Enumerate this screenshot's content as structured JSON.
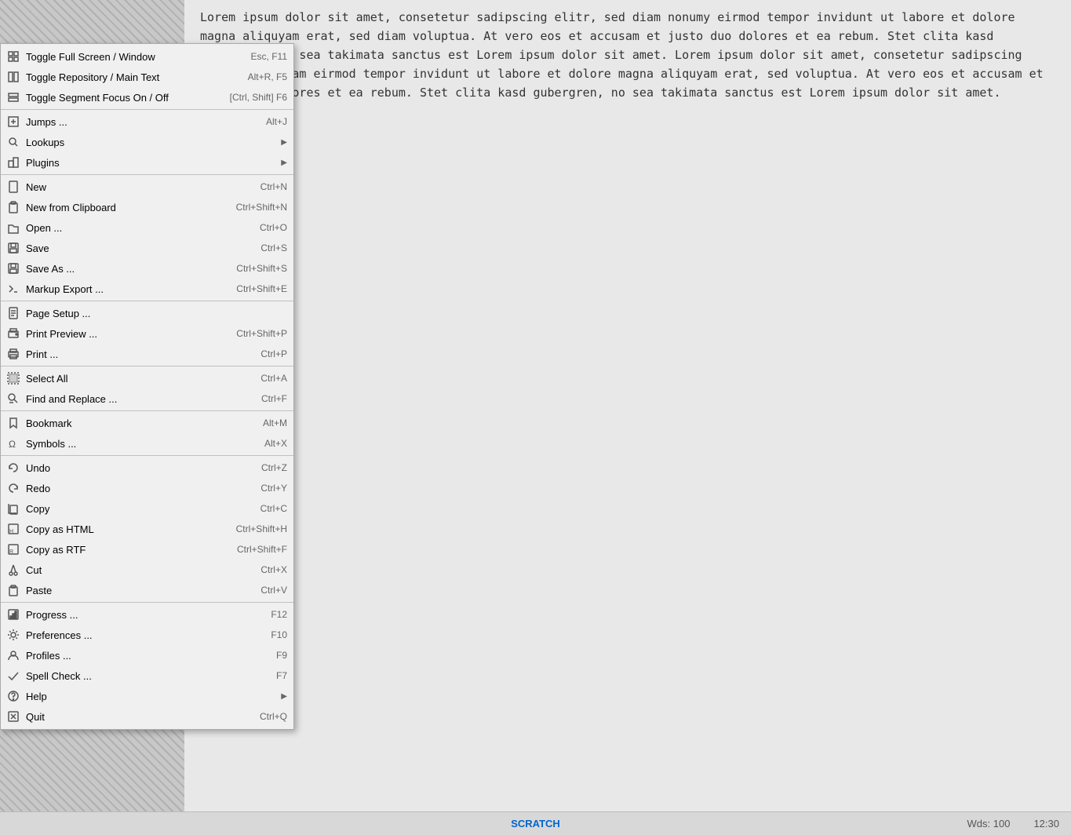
{
  "app": {
    "status": {
      "scratch_label": "SCRATCH",
      "wds_label": "Wds: 100",
      "time_label": "12:30"
    },
    "main_text": "Lorem ipsum dolor sit amet, consetetur sadipscing elitr, sed diam nonumy eirmod tempor invidunt ut labore et dolore magna aliquyam erat, sed diam voluptua. At vero eos et accusam et justo duo dolores et ea rebum. Stet clita kasd gubergren, no sea takimata sanctus est Lorem ipsum dolor sit amet. Lorem ipsum dolor sit amet, consetetur sadipscing elitr, sed diam eirmod tempor invidunt ut labore et dolore magna aliquyam erat, sed voluptua. At vero eos et accusam et justo duo dolores et ea rebum. Stet clita kasd gubergren, no sea takimata sanctus est Lorem ipsum dolor sit amet."
  },
  "menu": {
    "items": [
      {
        "id": "toggle-fullscreen",
        "label": "Toggle Full Screen / Window",
        "shortcut": "Esc, F11",
        "has_sub": false,
        "separator_after": false
      },
      {
        "id": "toggle-repo",
        "label": "Toggle Repository / Main Text",
        "shortcut": "Alt+R, F5",
        "has_sub": false,
        "separator_after": false
      },
      {
        "id": "toggle-segment",
        "label": "Toggle Segment Focus On / Off",
        "shortcut": "[Ctrl, Shift] F6",
        "has_sub": false,
        "separator_after": true
      },
      {
        "id": "jumps",
        "label": "Jumps ...",
        "shortcut": "Alt+J",
        "has_sub": false,
        "separator_after": false
      },
      {
        "id": "lookups",
        "label": "Lookups",
        "shortcut": "",
        "has_sub": true,
        "separator_after": false
      },
      {
        "id": "plugins",
        "label": "Plugins",
        "shortcut": "",
        "has_sub": true,
        "separator_after": true
      },
      {
        "id": "new",
        "label": "New",
        "shortcut": "Ctrl+N",
        "has_sub": false,
        "separator_after": false
      },
      {
        "id": "new-clipboard",
        "label": "New from Clipboard",
        "shortcut": "Ctrl+Shift+N",
        "has_sub": false,
        "separator_after": false
      },
      {
        "id": "open",
        "label": "Open ...",
        "shortcut": "Ctrl+O",
        "has_sub": false,
        "separator_after": false
      },
      {
        "id": "save",
        "label": "Save",
        "shortcut": "Ctrl+S",
        "has_sub": false,
        "separator_after": false
      },
      {
        "id": "save-as",
        "label": "Save As ...",
        "shortcut": "Ctrl+Shift+S",
        "has_sub": false,
        "separator_after": false
      },
      {
        "id": "markup-export",
        "label": "Markup Export ...",
        "shortcut": "Ctrl+Shift+E",
        "has_sub": false,
        "separator_after": true
      },
      {
        "id": "page-setup",
        "label": "Page Setup ...",
        "shortcut": "",
        "has_sub": false,
        "separator_after": false
      },
      {
        "id": "print-preview",
        "label": "Print Preview ...",
        "shortcut": "Ctrl+Shift+P",
        "has_sub": false,
        "separator_after": false
      },
      {
        "id": "print",
        "label": "Print ...",
        "shortcut": "Ctrl+P",
        "has_sub": false,
        "separator_after": true
      },
      {
        "id": "select-all",
        "label": "Select All",
        "shortcut": "Ctrl+A",
        "has_sub": false,
        "separator_after": false
      },
      {
        "id": "find-replace",
        "label": "Find and Replace ...",
        "shortcut": "Ctrl+F",
        "has_sub": false,
        "separator_after": true
      },
      {
        "id": "bookmark",
        "label": "Bookmark",
        "shortcut": "Alt+M",
        "has_sub": false,
        "separator_after": false
      },
      {
        "id": "symbols",
        "label": "Symbols ...",
        "shortcut": "Alt+X",
        "has_sub": false,
        "separator_after": true
      },
      {
        "id": "undo",
        "label": "Undo",
        "shortcut": "Ctrl+Z",
        "has_sub": false,
        "separator_after": false
      },
      {
        "id": "redo",
        "label": "Redo",
        "shortcut": "Ctrl+Y",
        "has_sub": false,
        "separator_after": false
      },
      {
        "id": "copy",
        "label": "Copy",
        "shortcut": "Ctrl+C",
        "has_sub": false,
        "separator_after": false
      },
      {
        "id": "copy-html",
        "label": "Copy as HTML",
        "shortcut": "Ctrl+Shift+H",
        "has_sub": false,
        "separator_after": false
      },
      {
        "id": "copy-rtf",
        "label": "Copy as RTF",
        "shortcut": "Ctrl+Shift+F",
        "has_sub": false,
        "separator_after": false
      },
      {
        "id": "cut",
        "label": "Cut",
        "shortcut": "Ctrl+X",
        "has_sub": false,
        "separator_after": false
      },
      {
        "id": "paste",
        "label": "Paste",
        "shortcut": "Ctrl+V",
        "has_sub": false,
        "separator_after": true
      },
      {
        "id": "progress",
        "label": "Progress ...",
        "shortcut": "F12",
        "has_sub": false,
        "separator_after": false
      },
      {
        "id": "preferences",
        "label": "Preferences ...",
        "shortcut": "F10",
        "has_sub": false,
        "separator_after": false
      },
      {
        "id": "profiles",
        "label": "Profiles ...",
        "shortcut": "F9",
        "has_sub": false,
        "separator_after": false
      },
      {
        "id": "spell-check",
        "label": "Spell Check ...",
        "shortcut": "F7",
        "has_sub": false,
        "separator_after": false
      },
      {
        "id": "help",
        "label": "Help",
        "shortcut": "",
        "has_sub": true,
        "separator_after": false
      },
      {
        "id": "quit",
        "label": "Quit",
        "shortcut": "Ctrl+Q",
        "has_sub": false,
        "separator_after": false
      }
    ]
  }
}
